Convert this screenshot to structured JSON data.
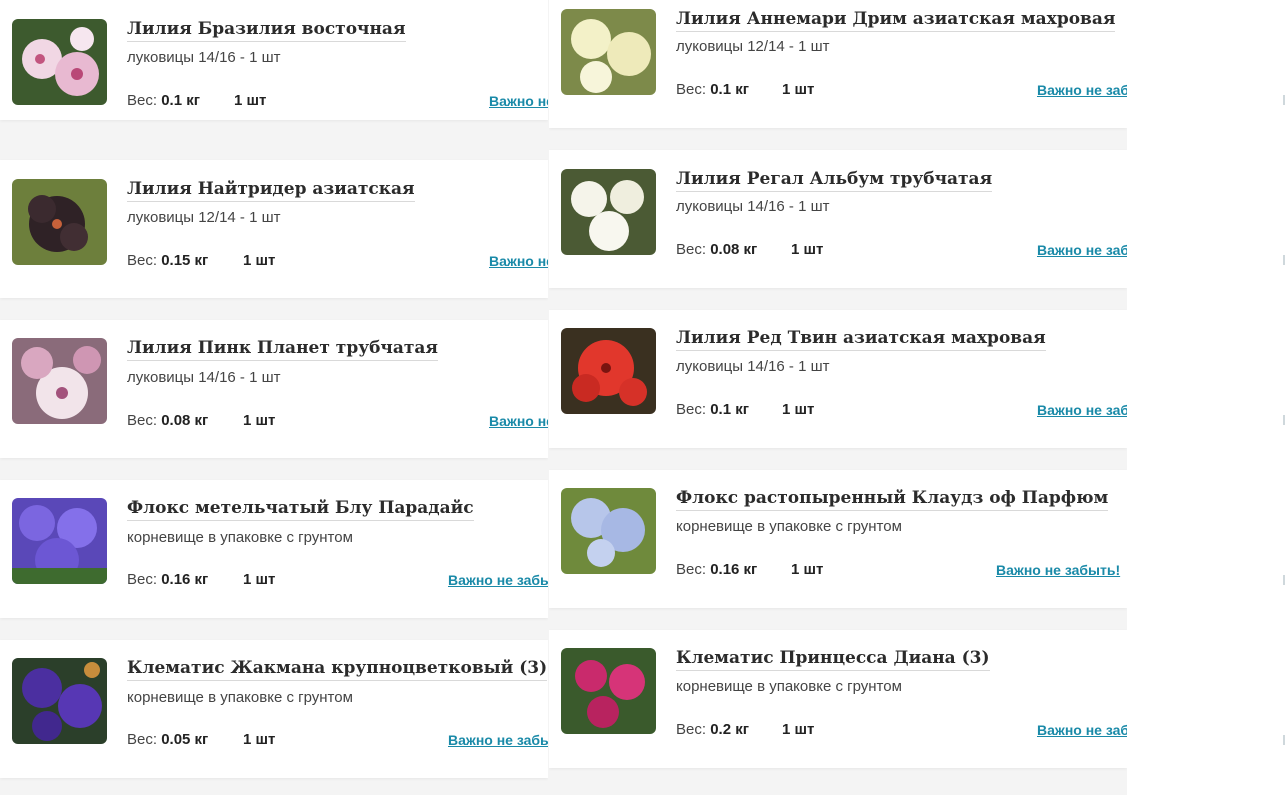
{
  "labels": {
    "weight_prefix": "Вес:",
    "remind": "Важно не забыть!",
    "remind_clip_short": "Важно не",
    "remind_clip_mid": "Важно не заб",
    "remind_clip_long": "Важно не забы"
  },
  "left": [
    {
      "title": "Лилия Бразилия восточная",
      "subtitle": "луковицы 14/16 - 1 шт",
      "weight": "0.1 кг",
      "qty": "1 шт",
      "remind": "Важно не"
    },
    {
      "title": "Лилия Найтридер азиатская",
      "subtitle": "луковицы 12/14 - 1 шт",
      "weight": "0.15 кг",
      "qty": "1 шт",
      "remind": "Важно не"
    },
    {
      "title": "Лилия Пинк Планет трубчатая",
      "subtitle": "луковицы 14/16 - 1 шт",
      "weight": "0.08 кг",
      "qty": "1 шт",
      "remind": "Важно не"
    },
    {
      "title": "Флокс метельчатый Блу Парадайс",
      "subtitle": "корневище в упаковке с грунтом",
      "weight": "0.16 кг",
      "qty": "1 шт",
      "remind": "Важно не забы"
    },
    {
      "title": "Клематис Жакмана крупноцветковый (3)",
      "subtitle": "корневище в упаковке с грунтом",
      "weight": "0.05 кг",
      "qty": "1 шт",
      "remind": "Важно не забы"
    }
  ],
  "middle": [
    {
      "title": "Лилия Аннемари Дрим азиатская махровая",
      "subtitle": "луковицы 12/14 - 1 шт",
      "weight": "0.1 кг",
      "qty": "1 шт",
      "remind": "Важно не заб"
    },
    {
      "title": "Лилия Регал Альбум трубчатая",
      "subtitle": "луковицы 14/16 - 1 шт",
      "weight": "0.08 кг",
      "qty": "1 шт",
      "remind": "Важно не заб"
    },
    {
      "title": "Лилия Ред Твин азиатская махровая",
      "subtitle": "луковицы 14/16 - 1 шт",
      "weight": "0.1 кг",
      "qty": "1 шт",
      "remind": "Важно не заб"
    },
    {
      "title": "Флокс растопыренный Клаудз оф Парфюм",
      "subtitle": "корневище в упаковке с грунтом",
      "weight": "0.16 кг",
      "qty": "1 шт",
      "remind": "Важно не забыть!"
    },
    {
      "title": "Клематис Принцесса Диана (3)",
      "subtitle": "корневище в упаковке с грунтом",
      "weight": "0.2 кг",
      "qty": "1 шт",
      "remind": "Важно не заб"
    }
  ],
  "colors": {
    "link": "#1a8aa8",
    "title": "#2b2b2b"
  }
}
